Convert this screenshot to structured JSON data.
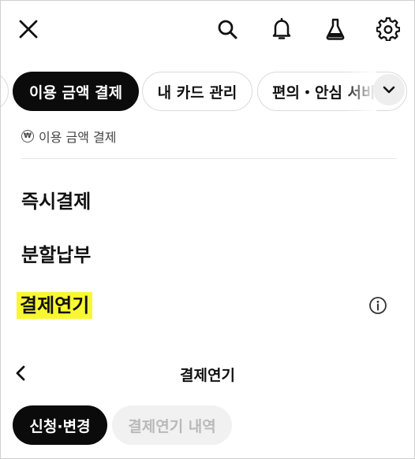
{
  "topbar": {
    "close_icon": "close-icon",
    "search_icon": "search-icon",
    "bell_icon": "bell-icon",
    "lab_icon": "flask-icon",
    "settings_icon": "gear-icon"
  },
  "tabs": {
    "active_label": "이용 금액 결제",
    "cards_label": "내 카드 관리",
    "convenience_label": "편의・안심 서비스"
  },
  "section": {
    "label": "이용 금액 결제",
    "currency_symbol": "₩"
  },
  "menu": {
    "items": [
      {
        "label": "즉시결제"
      },
      {
        "label": "분할납부"
      },
      {
        "label": "결제연기"
      }
    ]
  },
  "sheet": {
    "title": "결제연기"
  },
  "segments": {
    "apply_label": "신청·변경",
    "history_label": "결제연기 내역"
  },
  "colors": {
    "accent_dark": "#0b0b0b",
    "highlight": "#f9f733",
    "pill_inactive_bg": "#f1f1f1",
    "pill_inactive_text": "#b9b9b9"
  }
}
